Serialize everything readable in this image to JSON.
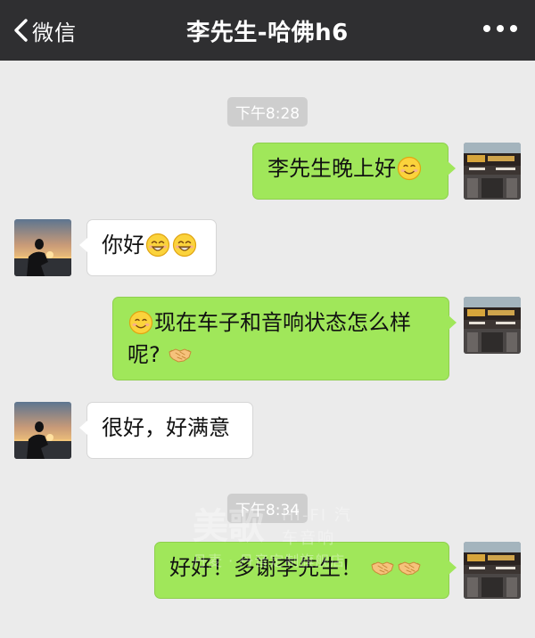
{
  "header": {
    "back_label": "微信",
    "title": "李先生-哈佛h6"
  },
  "messages": {
    "time1": "下午8:28",
    "m1": "李先生晚上好",
    "m2": "你好",
    "m3_line1": "现在车子和音响状态怎么样",
    "m3_line2": "呢?",
    "m4": "很好，好满意",
    "time2": "下午8:34",
    "m5": "好好！多谢李先生！"
  },
  "watermark": {
    "brand": "美歌",
    "sub": "HI-FI 汽车音响",
    "line": "丹麦 · 丹音定制旗舰店"
  },
  "colors": {
    "topbar": "#2f2f31",
    "background": "#ebebeb",
    "sent_bubble": "#a0e75a",
    "recv_bubble": "#ffffff",
    "time_badge": "#cecece"
  },
  "icons": {
    "back": "chevron-left-icon",
    "more": "more-dots-icon",
    "smile": "smile-emoji-icon",
    "grin": "grin-emoji-icon",
    "handshake": "handshake-emoji-icon"
  }
}
